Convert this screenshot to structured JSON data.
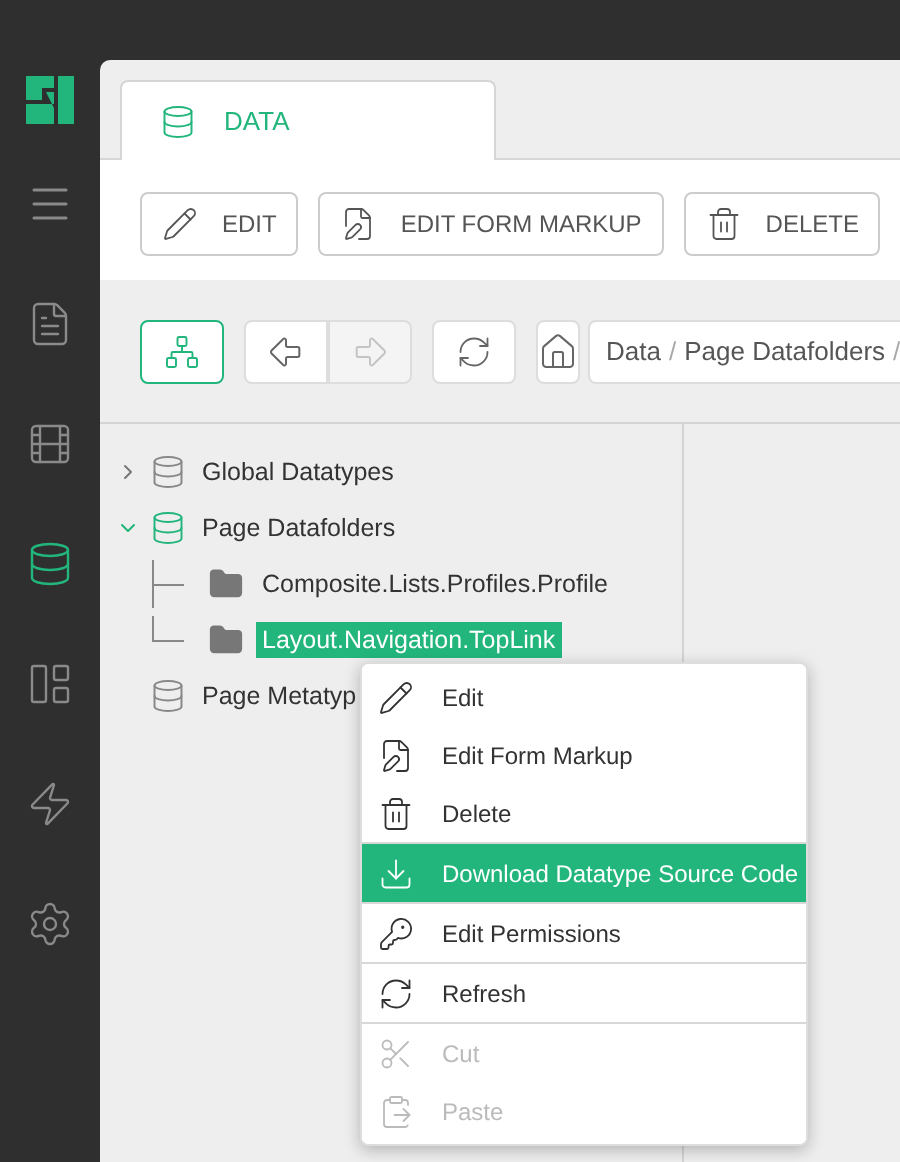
{
  "sidebar": {
    "items": [
      {
        "selected": false
      },
      {
        "selected": false
      },
      {
        "selected": true
      },
      {
        "selected": false
      },
      {
        "selected": false
      },
      {
        "selected": false
      }
    ]
  },
  "tabs": [
    {
      "label": "DATA",
      "selected": true
    }
  ],
  "toolbar": {
    "buttons": [
      "EDIT",
      "EDIT FORM MARKUP",
      "DELETE"
    ]
  },
  "navigation": {
    "tree_view_active": true,
    "back_disabled": false,
    "forward_disabled": true,
    "breadcrumb": [
      "Data",
      "Page Datafolders"
    ],
    "separator": "/"
  },
  "tree": [
    {
      "label": "Global Datatypes",
      "expanded": false,
      "selected": false,
      "kind": "datatype"
    },
    {
      "label": "Page Datafolders",
      "expanded": true,
      "selected": false,
      "kind": "datatype",
      "children": [
        {
          "label": "Composite.Lists.Profiles.Profile",
          "selected": false,
          "kind": "folder"
        },
        {
          "label": "Layout.Navigation.TopLink",
          "selected": true,
          "kind": "folder"
        }
      ]
    },
    {
      "label": "Page Metatyp",
      "selected": false,
      "kind": "datatype"
    }
  ],
  "context_menu": {
    "groups": [
      [
        {
          "label": "Edit",
          "selected": false,
          "disabled": false
        },
        {
          "label": "Edit Form Markup",
          "selected": false,
          "disabled": false
        },
        {
          "label": "Delete",
          "selected": false,
          "disabled": false
        }
      ],
      [
        {
          "label": "Download Datatype Source Code",
          "selected": true,
          "disabled": false
        }
      ],
      [
        {
          "label": "Edit Permissions",
          "selected": false,
          "disabled": false
        }
      ],
      [
        {
          "label": "Refresh",
          "selected": false,
          "disabled": false
        }
      ],
      [
        {
          "label": "Cut",
          "selected": false,
          "disabled": true
        },
        {
          "label": "Paste",
          "selected": false,
          "disabled": true
        }
      ]
    ]
  }
}
